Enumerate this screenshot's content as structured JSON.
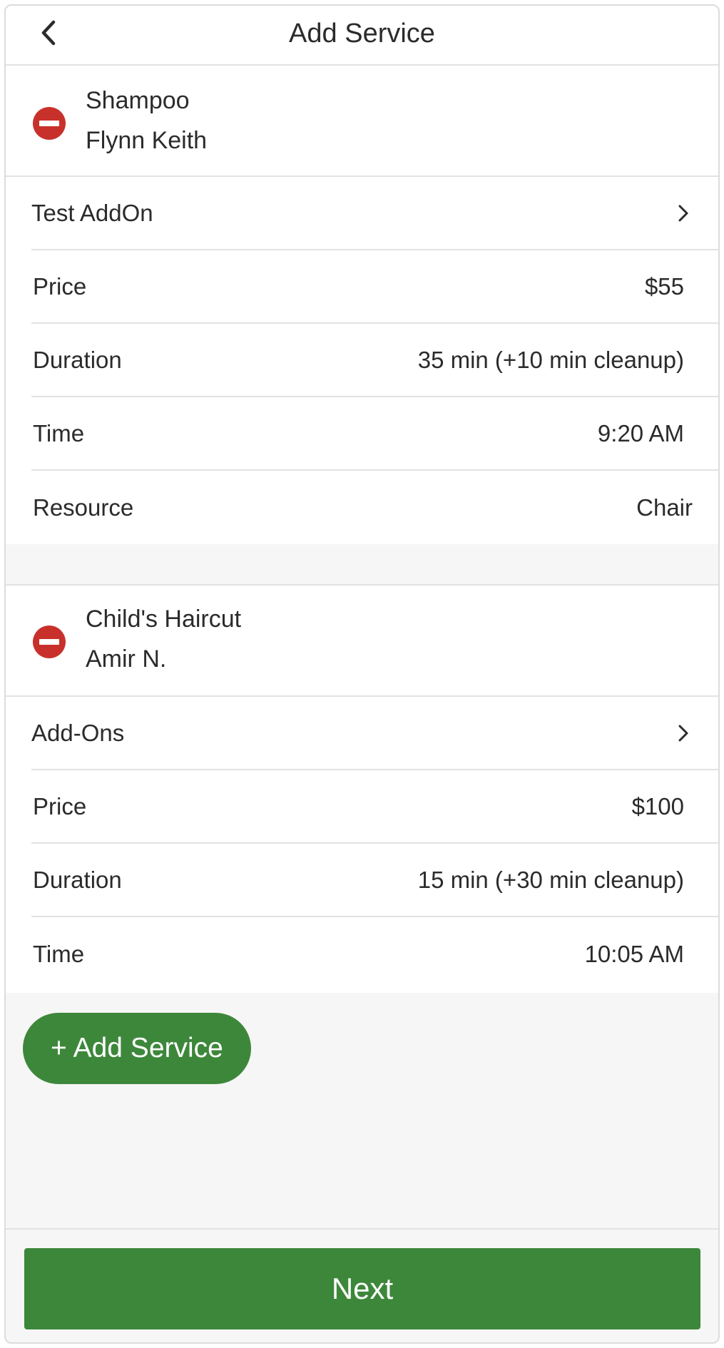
{
  "header": {
    "title": "Add Service",
    "back_icon": "chevron-left-icon"
  },
  "services": [
    {
      "name": "Shampoo",
      "staff": "Flynn Keith",
      "addons_label": "Test AddOn",
      "price_label": "Price",
      "price_value": "$55",
      "duration_label": "Duration",
      "duration_value": "35 min (+10 min cleanup)",
      "time_label": "Time",
      "time_value": "9:20 AM",
      "resource_label": "Resource",
      "resource_value": "Chair"
    },
    {
      "name": "Child's Haircut",
      "staff": "Amir N.",
      "addons_label": "Add-Ons",
      "price_label": "Price",
      "price_value": "$100",
      "duration_label": "Duration",
      "duration_value": "15 min (+30 min cleanup)",
      "time_label": "Time",
      "time_value": "10:05 AM"
    }
  ],
  "add_service_label": "+ Add Service",
  "next_label": "Next",
  "colors": {
    "accent_green": "#3d873a",
    "remove_red": "#c8312b",
    "background": "#f6f6f6"
  }
}
